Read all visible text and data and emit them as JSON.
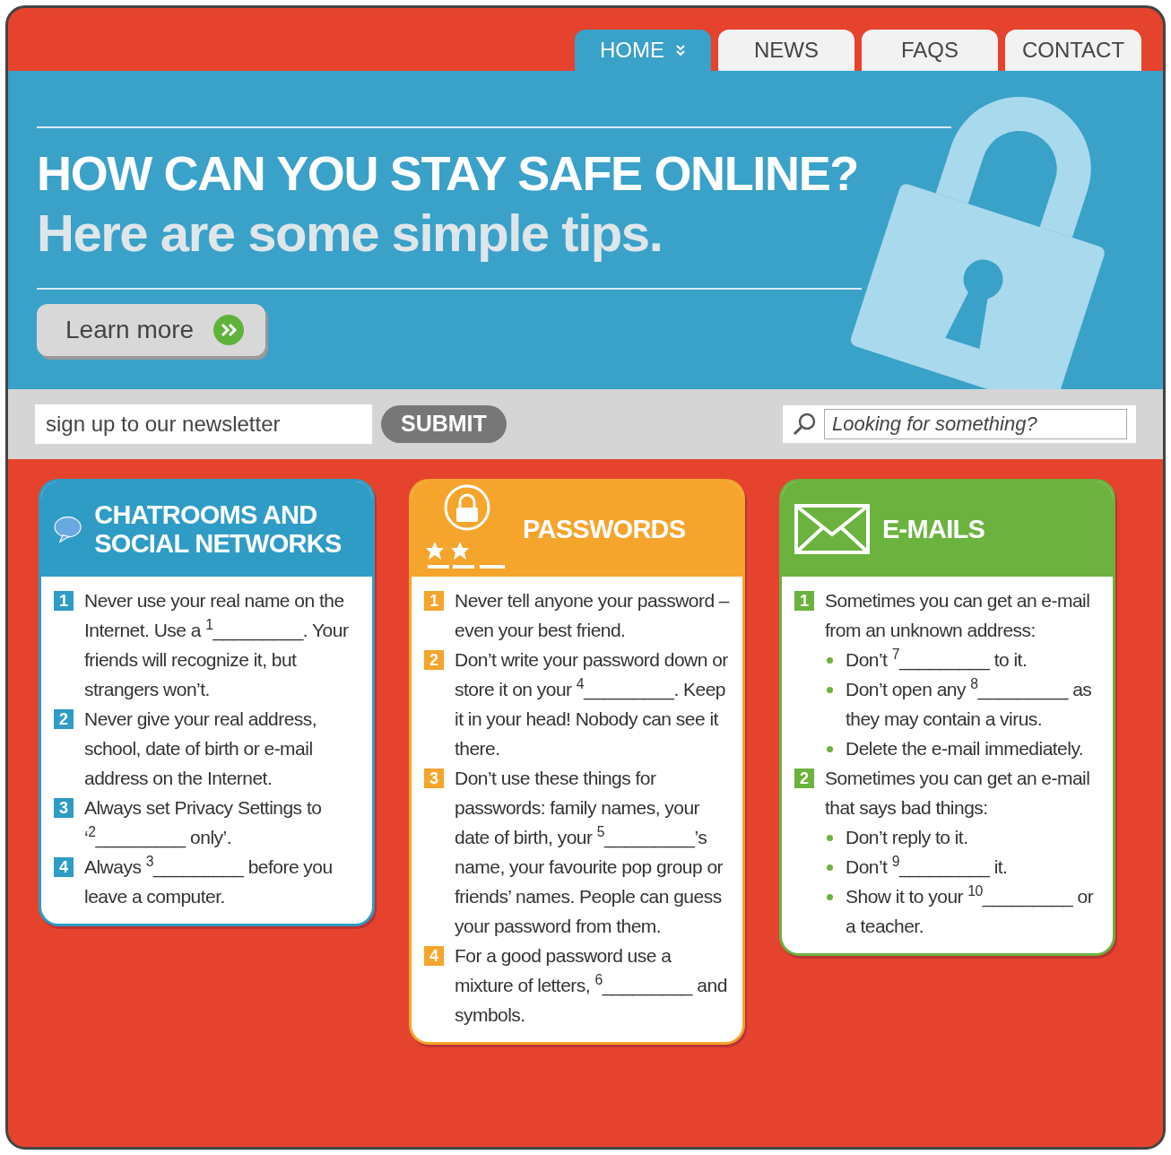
{
  "nav": {
    "tabs": [
      {
        "label": "HOME",
        "selected": true
      },
      {
        "label": "NEWS",
        "selected": false
      },
      {
        "label": "FAQS",
        "selected": false
      },
      {
        "label": "CONTACT",
        "selected": false
      }
    ]
  },
  "hero": {
    "title": "HOW CAN YOU STAY SAFE ONLINE?",
    "subtitle": "Here are some simple tips.",
    "button": "Learn more"
  },
  "toolbar": {
    "newsletter": {
      "placeholder": "sign up to our newsletter"
    },
    "submit": "SUBMIT",
    "search": {
      "placeholder": "Looking for something?"
    }
  },
  "cards": [
    {
      "kind": "chat",
      "title": "CHATROOMS AND SOCIAL NETWORKS",
      "color": "#2f9cc6",
      "items": [
        {
          "number": "1",
          "text": "Never use your real name on the Internet. Use a $^{1}$_________. Your friends will recognize it, but strangers won’t."
        },
        {
          "number": "2",
          "text": "Never give your real address, school, date of birth or e-mail address on the Internet."
        },
        {
          "number": "3",
          "text": "Always set Privacy Settings to ‘$^{2}$_________ only’."
        },
        {
          "number": "4",
          "text": "Always $^{3}$_________ before you leave a computer."
        }
      ]
    },
    {
      "kind": "lock",
      "title": "PASSWORDS",
      "color": "#f5a42c",
      "items": [
        {
          "number": "1",
          "text": "Never tell anyone your password – even your best friend."
        },
        {
          "number": "2",
          "text": "Don’t write your password down or store it on your $^{4}$_________. Keep it in your head! Nobody can see it there."
        },
        {
          "number": "3",
          "text": "Don’t use these things for passwords: family names, your date of birth, your $^{5}$_________’s name, your favourite pop group or friends’ names. People can guess your password from them."
        },
        {
          "number": "4",
          "text": "For a good password use a mixture of letters, $^{6}$_________ and symbols."
        }
      ]
    },
    {
      "kind": "envelope",
      "title": "E-MAILS",
      "color": "#6bb33e",
      "items": [
        {
          "number": "1",
          "text": "Sometimes you can get an e-mail from an unknown address:",
          "children": [
            {
              "text": "Don’t $^{7}$_________ to it."
            },
            {
              "text": "Don’t open any $^{8}$_________ as they may contain a virus."
            },
            {
              "text": "Delete the e-mail immediately."
            }
          ]
        },
        {
          "number": "2",
          "text": "Sometimes you can get an e-mail that says bad things:",
          "children": [
            {
              "text": "Don’t reply to it."
            },
            {
              "text": "Don’t $^{9}$_________ it."
            },
            {
              "text": "Show it to your $^{10}$_________ or a teacher."
            }
          ]
        }
      ]
    }
  ]
}
